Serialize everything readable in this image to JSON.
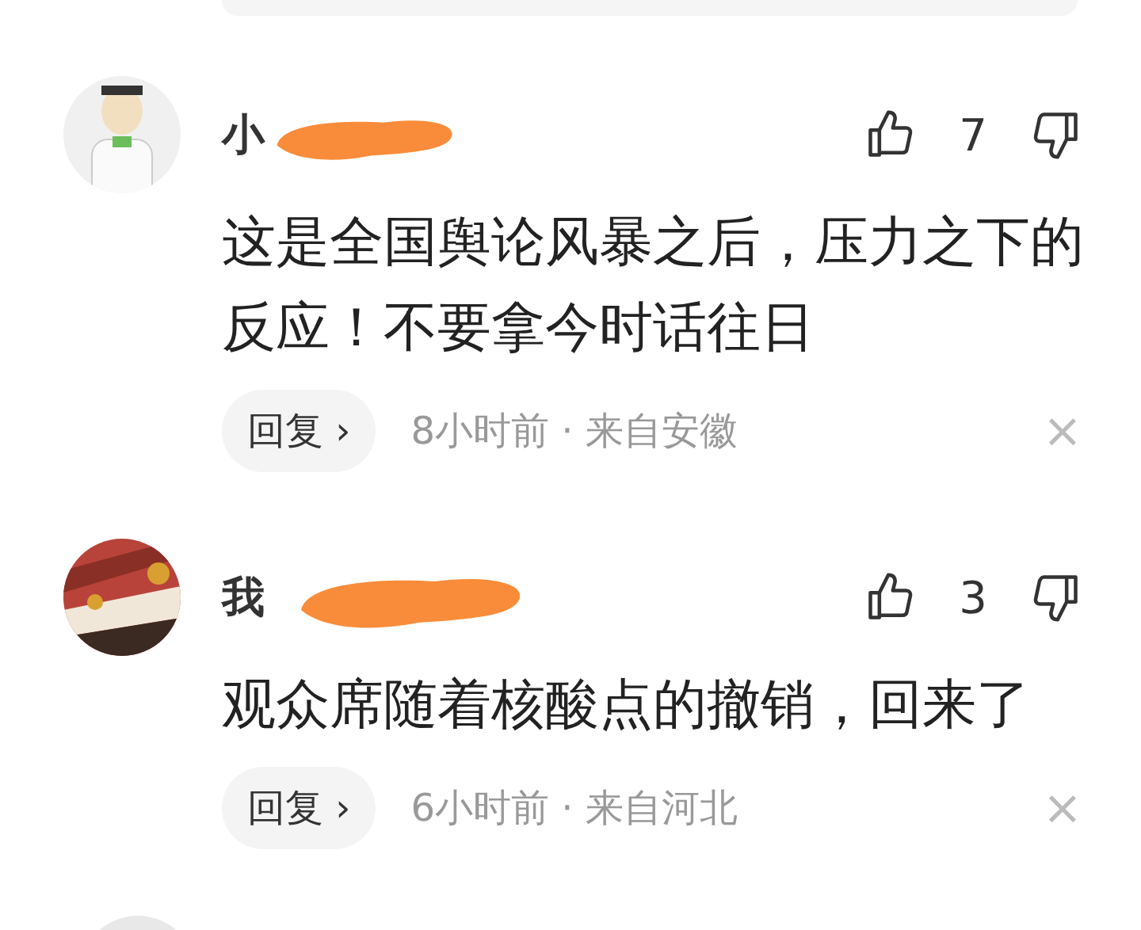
{
  "comments": [
    {
      "name": "小",
      "likes": "7",
      "text": "这是全国舆论风暴之后，压力之下的反应！不要拿今时话往日",
      "reply": "回复",
      "reply_arrow": "›",
      "meta": "8小时前 · 来自安徽",
      "close": "×"
    },
    {
      "name": "我",
      "likes": "3",
      "text": "观众席随着核酸点的撤销，回来了",
      "reply": "回复",
      "reply_arrow": "›",
      "meta": "6小时前 · 来自河北",
      "close": "×"
    }
  ]
}
